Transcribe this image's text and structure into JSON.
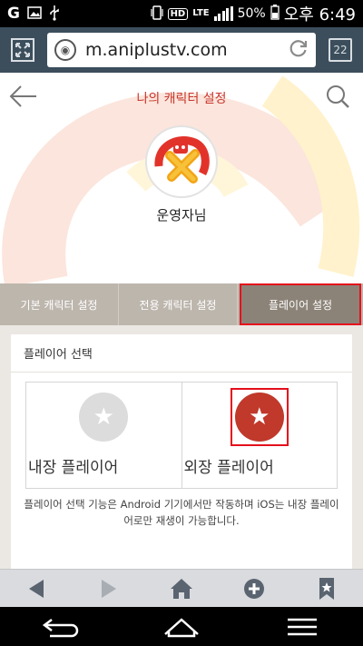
{
  "statusbar": {
    "hd_label": "HD",
    "lte_label": "LTE",
    "battery": "50%",
    "time": "오후 6:49"
  },
  "browser": {
    "url": "m.aniplustv.com",
    "tab_count": "22"
  },
  "page": {
    "title": "나의 캐릭터 설정",
    "nickname": "운영자님"
  },
  "tabs": [
    {
      "label": "기본 캐릭터 설정"
    },
    {
      "label": "전용 캐릭터 설정"
    },
    {
      "label": "플레이어 설정"
    }
  ],
  "player_panel": {
    "heading": "플레이어 선택",
    "options": [
      {
        "label": "내장 플레이어",
        "selected": false
      },
      {
        "label": "외장 플레이어",
        "selected": true
      }
    ],
    "note": "플레이어 선택 기능은 Android 기기에서만 작동하며 iOS는 내장 플레이어로만 재생이 가능합니다."
  },
  "colors": {
    "accent": "#c8372d",
    "selection_outline": "#e4101c",
    "url_bar_bg": "#3c4e5c",
    "tab_bg": "#bdb6ad",
    "tab_active_bg": "#8c8378"
  },
  "icons": {
    "statusbar": [
      "carrier-icon",
      "image-icon",
      "usb-icon",
      "vibrate-icon",
      "signal-icon",
      "battery-icon"
    ],
    "urlbar": [
      "expand-icon",
      "globe-icon",
      "refresh-icon",
      "tabs-icon"
    ],
    "page": [
      "back-arrow-icon",
      "search-icon",
      "star-icon"
    ],
    "browser_bottom": [
      "back-icon",
      "forward-icon",
      "home-icon",
      "add-icon",
      "bookmark-icon"
    ],
    "android_nav": [
      "nav-back-icon",
      "nav-home-icon",
      "nav-menu-icon"
    ]
  }
}
